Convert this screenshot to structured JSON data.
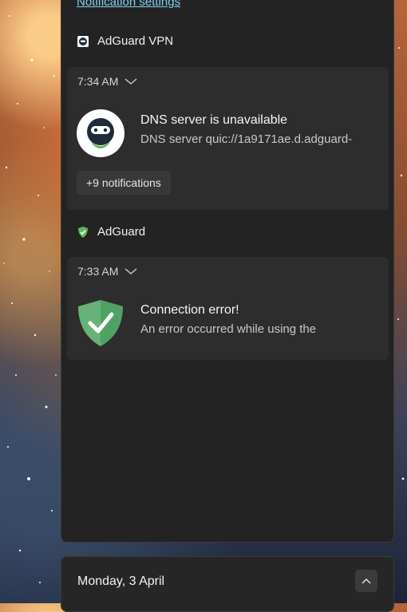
{
  "notification_center": {
    "settings_link": "Notification settings",
    "groups": [
      {
        "app_name": "AdGuard VPN",
        "time": "7:34 AM",
        "title": "DNS server is unavailable",
        "body": "DNS server quic://1a9171ae.d.adguard-",
        "more_label": "+9 notifications"
      },
      {
        "app_name": "AdGuard",
        "time": "7:33 AM",
        "title": "Connection error!",
        "body": "An error occurred while using the"
      }
    ]
  },
  "calendar": {
    "date_label": "Monday, 3 April"
  },
  "colors": {
    "link": "#7fd3f5",
    "adguard_green": "#5cb85c",
    "panel_bg": "#232323",
    "card_bg": "#2d2d2d"
  },
  "icons": [
    "adguard-vpn-icon",
    "adguard-shield-icon",
    "chevron-down-icon",
    "chevron-up-icon"
  ]
}
